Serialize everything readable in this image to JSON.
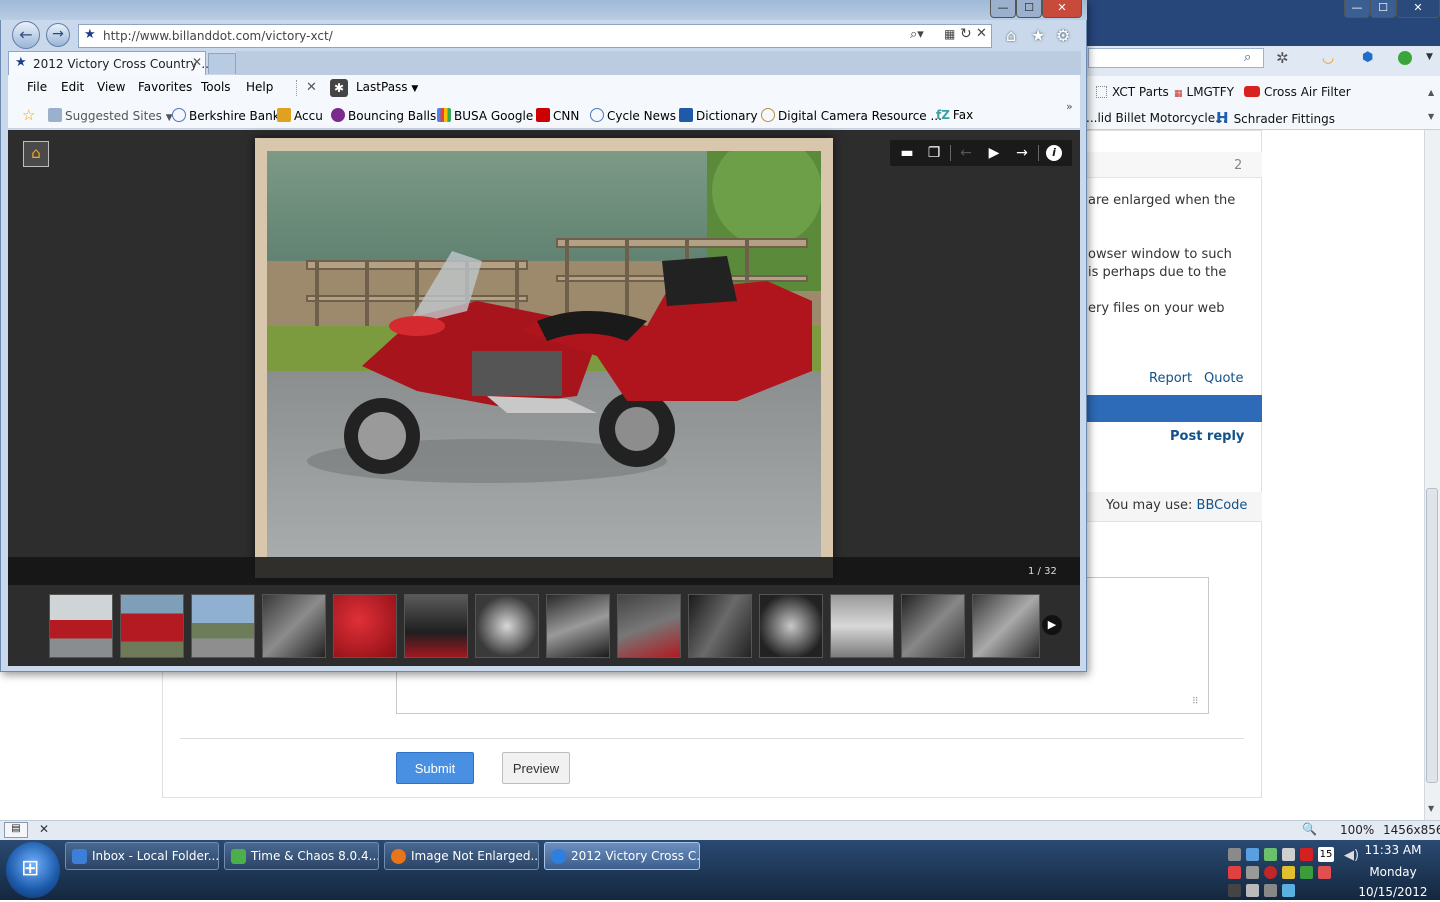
{
  "ie": {
    "address_url": "http://www.billanddot.com/victory-xct/",
    "tab_title": "2012 Victory Cross Country ...",
    "window_buttons": [
      "—",
      "☐",
      "✕"
    ],
    "menus": [
      "File",
      "Edit",
      "View",
      "Favorites",
      "Tools",
      "Help"
    ],
    "lastpass_label": "LastPass",
    "favorites": [
      "Suggested Sites",
      "Berkshire Bank",
      "Accu",
      "Bouncing Balls",
      "BUSA Google",
      "CNN",
      "Cycle News",
      "Dictionary",
      "Digital Camera Resource ...",
      "Fax"
    ]
  },
  "gallery": {
    "counter": "1 / 32",
    "thumbnail_count": 14
  },
  "background": {
    "window_buttons": [
      "—",
      "☐",
      "✕"
    ],
    "bookmarks_row1": [
      "XCT Parts",
      "LMGTFY",
      "Cross Air Filter"
    ],
    "bookmarks_row2": [
      "...lid Billet Motorcycle...",
      "Schrader Fittings"
    ],
    "post_number": "2",
    "post_lines": [
      "are enlarged when the",
      "owser window to such",
      "is perhaps due to the",
      "ery files on your web"
    ],
    "report_link": "Report",
    "quote_link": "Quote",
    "post_reply": "Post reply",
    "bbcode_prefix": "You may use:",
    "bbcode_link": "BBCode",
    "submit_label": "Submit",
    "preview_label": "Preview",
    "status_zoom": "100%",
    "status_resolution": "1456x856"
  },
  "taskbar": {
    "tasks": [
      "Inbox - Local Folder...",
      "Time & Chaos 8.0.4....",
      "Image Not Enlarged...",
      "2012 Victory Cross C..."
    ],
    "tray_badge": "15",
    "clock_time": "11:33 AM",
    "clock_day": "Monday",
    "clock_date": "10/15/2012"
  },
  "colors": {
    "accent": "#4a90e2",
    "forum_blue": "#2d6ab8",
    "link": "#105289",
    "gallery_bg": "#2d2d2d"
  }
}
